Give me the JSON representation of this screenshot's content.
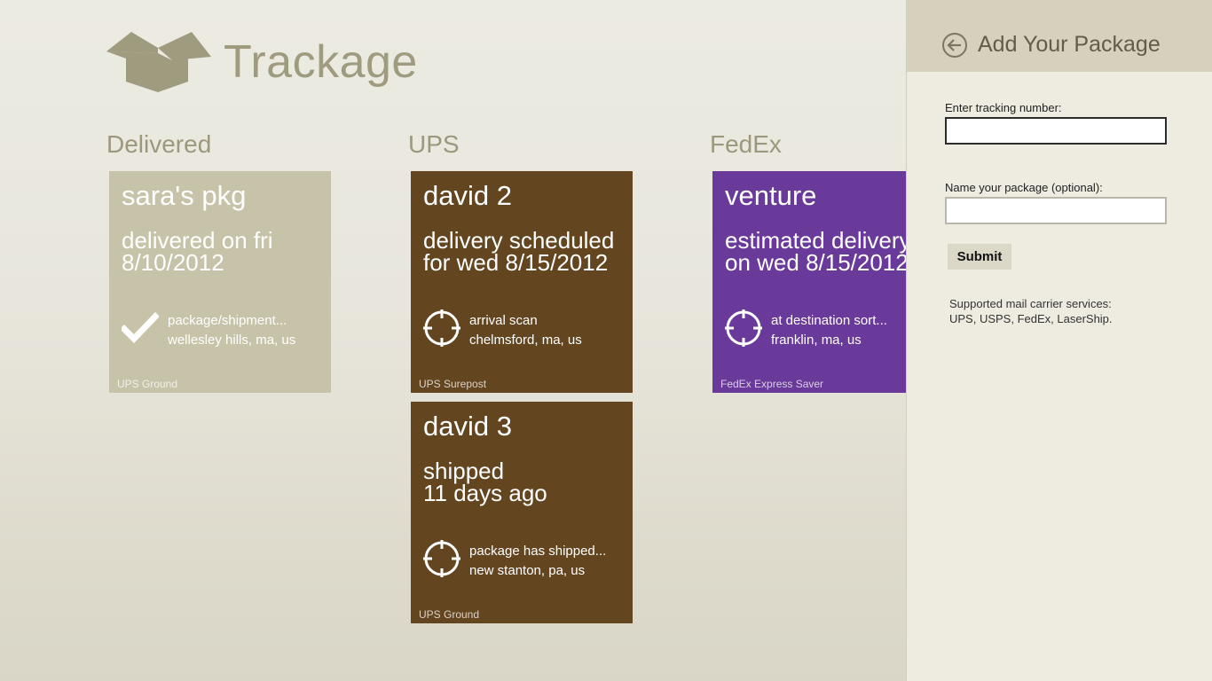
{
  "app": {
    "title": "Trackage",
    "logo_icon": "package-box-icon"
  },
  "colors": {
    "delivered_tile": "#c7c3a8",
    "ups_tile": "#634520",
    "fedex_tile": "#6a3a9a",
    "accent_text": "#9f9b7f"
  },
  "groups": [
    {
      "title": "Delivered",
      "tiles": [
        {
          "name": "sara's pkg",
          "status_line1": "delivered on fri",
          "status_line2": "8/10/2012",
          "event": "package/shipment...",
          "location": "wellesley hills, ma, us",
          "service": "UPS  Ground",
          "icon": "checkmark-icon"
        }
      ]
    },
    {
      "title": "UPS",
      "tiles": [
        {
          "name": "david 2",
          "status_line1": "delivery scheduled",
          "status_line2": "for wed 8/15/2012",
          "event": "arrival scan",
          "location": "chelmsford, ma, us",
          "service": "UPS  Surepost",
          "icon": "crosshair-icon"
        },
        {
          "name": "david 3",
          "status_line1": "shipped",
          "status_line2": "11 days ago",
          "event": "package has shipped...",
          "location": "new stanton, pa, us",
          "service": "UPS  Ground",
          "icon": "crosshair-icon"
        }
      ]
    },
    {
      "title": "FedEx",
      "tiles": [
        {
          "name": "venture",
          "status_line1": "estimated delivery",
          "status_line2": "on wed 8/15/2012",
          "event": "at destination sort...",
          "location": "franklin, ma, us",
          "service": "FedEx  Express Saver",
          "icon": "crosshair-icon"
        }
      ]
    }
  ],
  "panel": {
    "back_icon": "back-arrow-icon",
    "title": "Add Your Package",
    "tracking_label": "Enter tracking number:",
    "tracking_value": "",
    "name_label": "Name your package (optional):",
    "name_value": "",
    "submit_label": "Submit",
    "support_line1": "Supported mail carrier services:",
    "support_line2": "UPS, USPS, FedEx, LaserShip."
  }
}
